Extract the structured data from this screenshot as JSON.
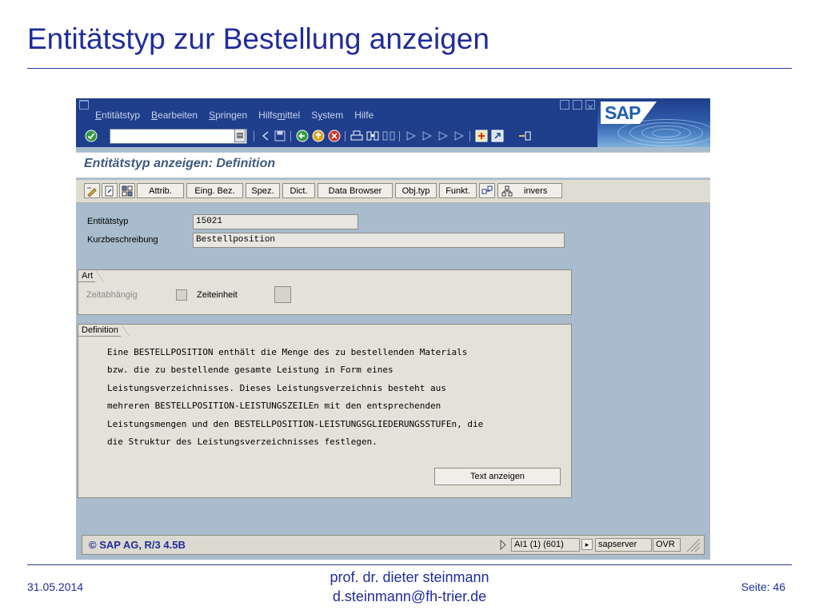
{
  "slide": {
    "title": "Entitätstyp zur Bestellung anzeigen",
    "date": "31.05.2014",
    "author_name": "prof. dr. dieter steinmann",
    "author_email": "d.steinmann@fh-trier.de",
    "page": "Seite: 46"
  },
  "sap": {
    "menu": [
      {
        "pre": "",
        "u": "E",
        "post": "ntitätstyp"
      },
      {
        "pre": "",
        "u": "B",
        "post": "earbeiten"
      },
      {
        "pre": "",
        "u": "S",
        "post": "pringen"
      },
      {
        "pre": "Hilfs",
        "u": "m",
        "post": "ittel"
      },
      {
        "pre": "S",
        "u": "y",
        "post": "stem"
      },
      {
        "pre": "",
        "u": "",
        "post": "Hilfe"
      }
    ],
    "screen_title": "Entitätstyp anzeigen: Definition",
    "app_buttons": [
      "Attrib.",
      "Eing. Bez.",
      "Spez.",
      "Dict.",
      "Data Browser",
      "Obj.typ",
      "Funkt.",
      "invers"
    ],
    "fields": {
      "entitaetstyp_label": "Entitätstyp",
      "entitaetstyp_value": "15021",
      "kurzbeschreibung_label": "Kurzbeschreibung",
      "kurzbeschreibung_value": "Bestellposition"
    },
    "art": {
      "title": "Art",
      "zeitabhaengig_label": "Zeitabhängig",
      "zeiteinheit_label": "Zeiteinheit"
    },
    "definition": {
      "title": "Definition",
      "lines": [
        "Eine BESTELLPOSITION enthält die Menge des zu bestellenden Materials",
        "bzw. die zu bestellende gesamte Leistung in Form eines",
        "Leistungsverzeichnisses. Dieses Leistungsverzeichnis besteht aus",
        "mehreren BESTELLPOSITION-LEISTUNGSZEILEn mit den entsprechenden",
        "Leistungsmengen und den BESTELLPOSITION-LEISTUNGSGLIEDERUNGSSTUFEn, die",
        "die Struktur des Leistungsverzeichnisses festlegen."
      ],
      "button": "Text anzeigen"
    },
    "status": {
      "copyright": "© SAP AG, R/3 4.5B",
      "system": "AI1 (1) (601)",
      "server": "sapserver",
      "mode": "OVR"
    },
    "logo_text": "SAP"
  }
}
